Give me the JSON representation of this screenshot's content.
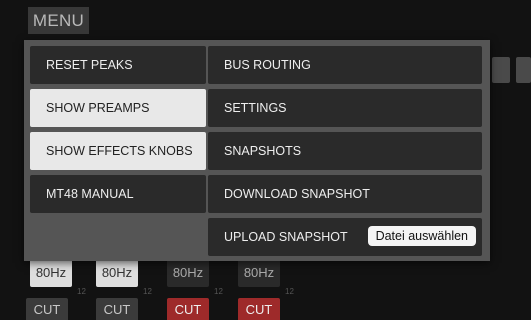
{
  "header": {
    "menu_label": "MENU"
  },
  "menu": {
    "left": [
      {
        "label": "RESET PEAKS",
        "active": false
      },
      {
        "label": "SHOW PREAMPS",
        "active": true
      },
      {
        "label": "SHOW EFFECTS KNOBS",
        "active": true
      },
      {
        "label": "MT48 MANUAL",
        "active": false
      }
    ],
    "right": [
      {
        "label": "BUS ROUTING"
      },
      {
        "label": "SETTINGS"
      },
      {
        "label": "SNAPSHOTS"
      },
      {
        "label": "DOWNLOAD SNAPSHOT"
      },
      {
        "label": "UPLOAD SNAPSHOT",
        "file_button": "Datei auswählen"
      }
    ]
  },
  "background": {
    "hz": [
      "80Hz",
      "80Hz",
      "80Hz",
      "80Hz"
    ],
    "cut": [
      "CUT",
      "CUT",
      "CUT",
      "CUT"
    ],
    "scale_marks": [
      "12",
      "12",
      "12",
      "12"
    ],
    "colors": {
      "cut_active": "#9e2a2a",
      "overlay": "#555555",
      "item": "#2a2a2a",
      "item_active": "#e8e8e8"
    }
  }
}
